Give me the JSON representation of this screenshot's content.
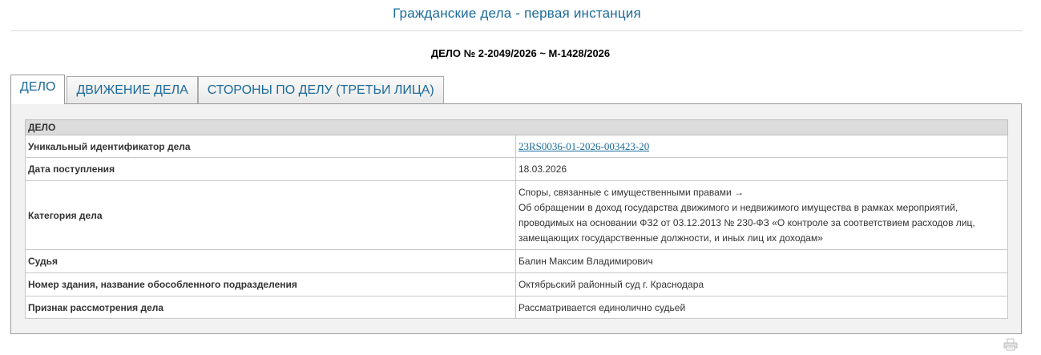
{
  "page": {
    "title": "Гражданские дела - первая инстанция",
    "case_number": "ДЕЛО № 2-2049/2026 ~ М-1428/2026"
  },
  "tabs": [
    {
      "label": "ДЕЛО",
      "active": true
    },
    {
      "label": "ДВИЖЕНИЕ ДЕЛА",
      "active": false
    },
    {
      "label": "СТОРОНЫ ПО ДЕЛУ (ТРЕТЬИ ЛИЦА)",
      "active": false
    }
  ],
  "case_table": {
    "section_header": "ДЕЛО",
    "rows": [
      {
        "label": "Уникальный идентификатор дела",
        "value": "23RS0036-01-2026-003423-20"
      },
      {
        "label": "Дата поступления",
        "value": "18.03.2026"
      },
      {
        "label": "Категория дела",
        "value_lines": [
          "Споры, связанные с имущественными правами →",
          "Об обращении в доход государства движимого и недвижимого имущества в рамках мероприятий,",
          "проводимых на основании ФЗ2 от 03.12.2013 № 230-ФЗ «О контроле за соответствием расходов лиц,",
          "замещающих государственные должности, и иных лиц их доходам»"
        ]
      },
      {
        "label": "Судья",
        "value": "Балин Максим Владимирович"
      },
      {
        "label": "Номер здания, название обособленного подразделения",
        "value": "Октябрьский районный суд г. Краснодара"
      },
      {
        "label": "Признак рассмотрения дела",
        "value": "Рассматривается единолично судьей"
      }
    ]
  },
  "icons": {
    "print": "printer-icon"
  },
  "colors": {
    "accent": "#1b6a9a",
    "header_bg": "#dcdcdc",
    "panel_bg": "#f2f2f2"
  }
}
